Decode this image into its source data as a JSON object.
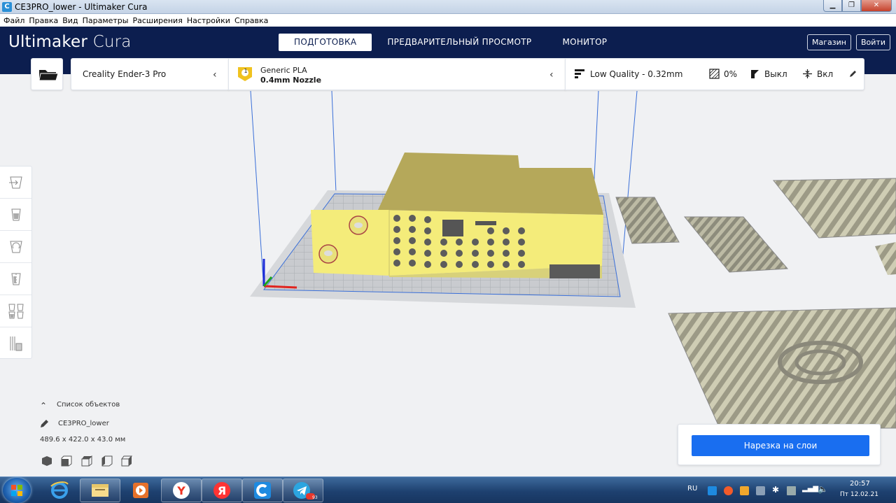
{
  "window": {
    "title": "CE3PRO_lower - Ultimaker Cura",
    "app_icon": "cura-icon"
  },
  "menu": [
    "Файл",
    "Правка",
    "Вид",
    "Параметры",
    "Расширения",
    "Настройки",
    "Справка"
  ],
  "brand": {
    "main": "Ultimaker",
    "sub": "Cura"
  },
  "stages": [
    {
      "label": "ПОДГОТОВКА",
      "active": true
    },
    {
      "label": "ПРЕДВАРИТЕЛЬНЫЙ ПРОСМОТР",
      "active": false
    },
    {
      "label": "МОНИТОР",
      "active": false
    }
  ],
  "header_buttons": {
    "marketplace": "Магазин",
    "signin": "Войти"
  },
  "printer": {
    "name": "Creality Ender-3 Pro"
  },
  "material": {
    "extruder_number": "1",
    "name": "Generic PLA",
    "nozzle": "0.4mm Nozzle"
  },
  "print_settings": {
    "profile": "Low Quality - 0.32mm",
    "infill": "0%",
    "support": "Выкл",
    "adhesion": "Вкл"
  },
  "object_list": {
    "header": "Список объектов",
    "object_name": "CE3PRO_lower",
    "dimensions": "489.6 x 422.0 x 43.0 мм"
  },
  "slice_button": "Нарезка на слои",
  "taskbar": {
    "lang": "RU",
    "time": "20:57",
    "date": "Пт 12.02.21",
    "badge": "93"
  },
  "colors": {
    "header": "#0c1e4f",
    "accent": "#196ef0",
    "model": "#f4ec7a",
    "model_top": "#b5a85a"
  }
}
